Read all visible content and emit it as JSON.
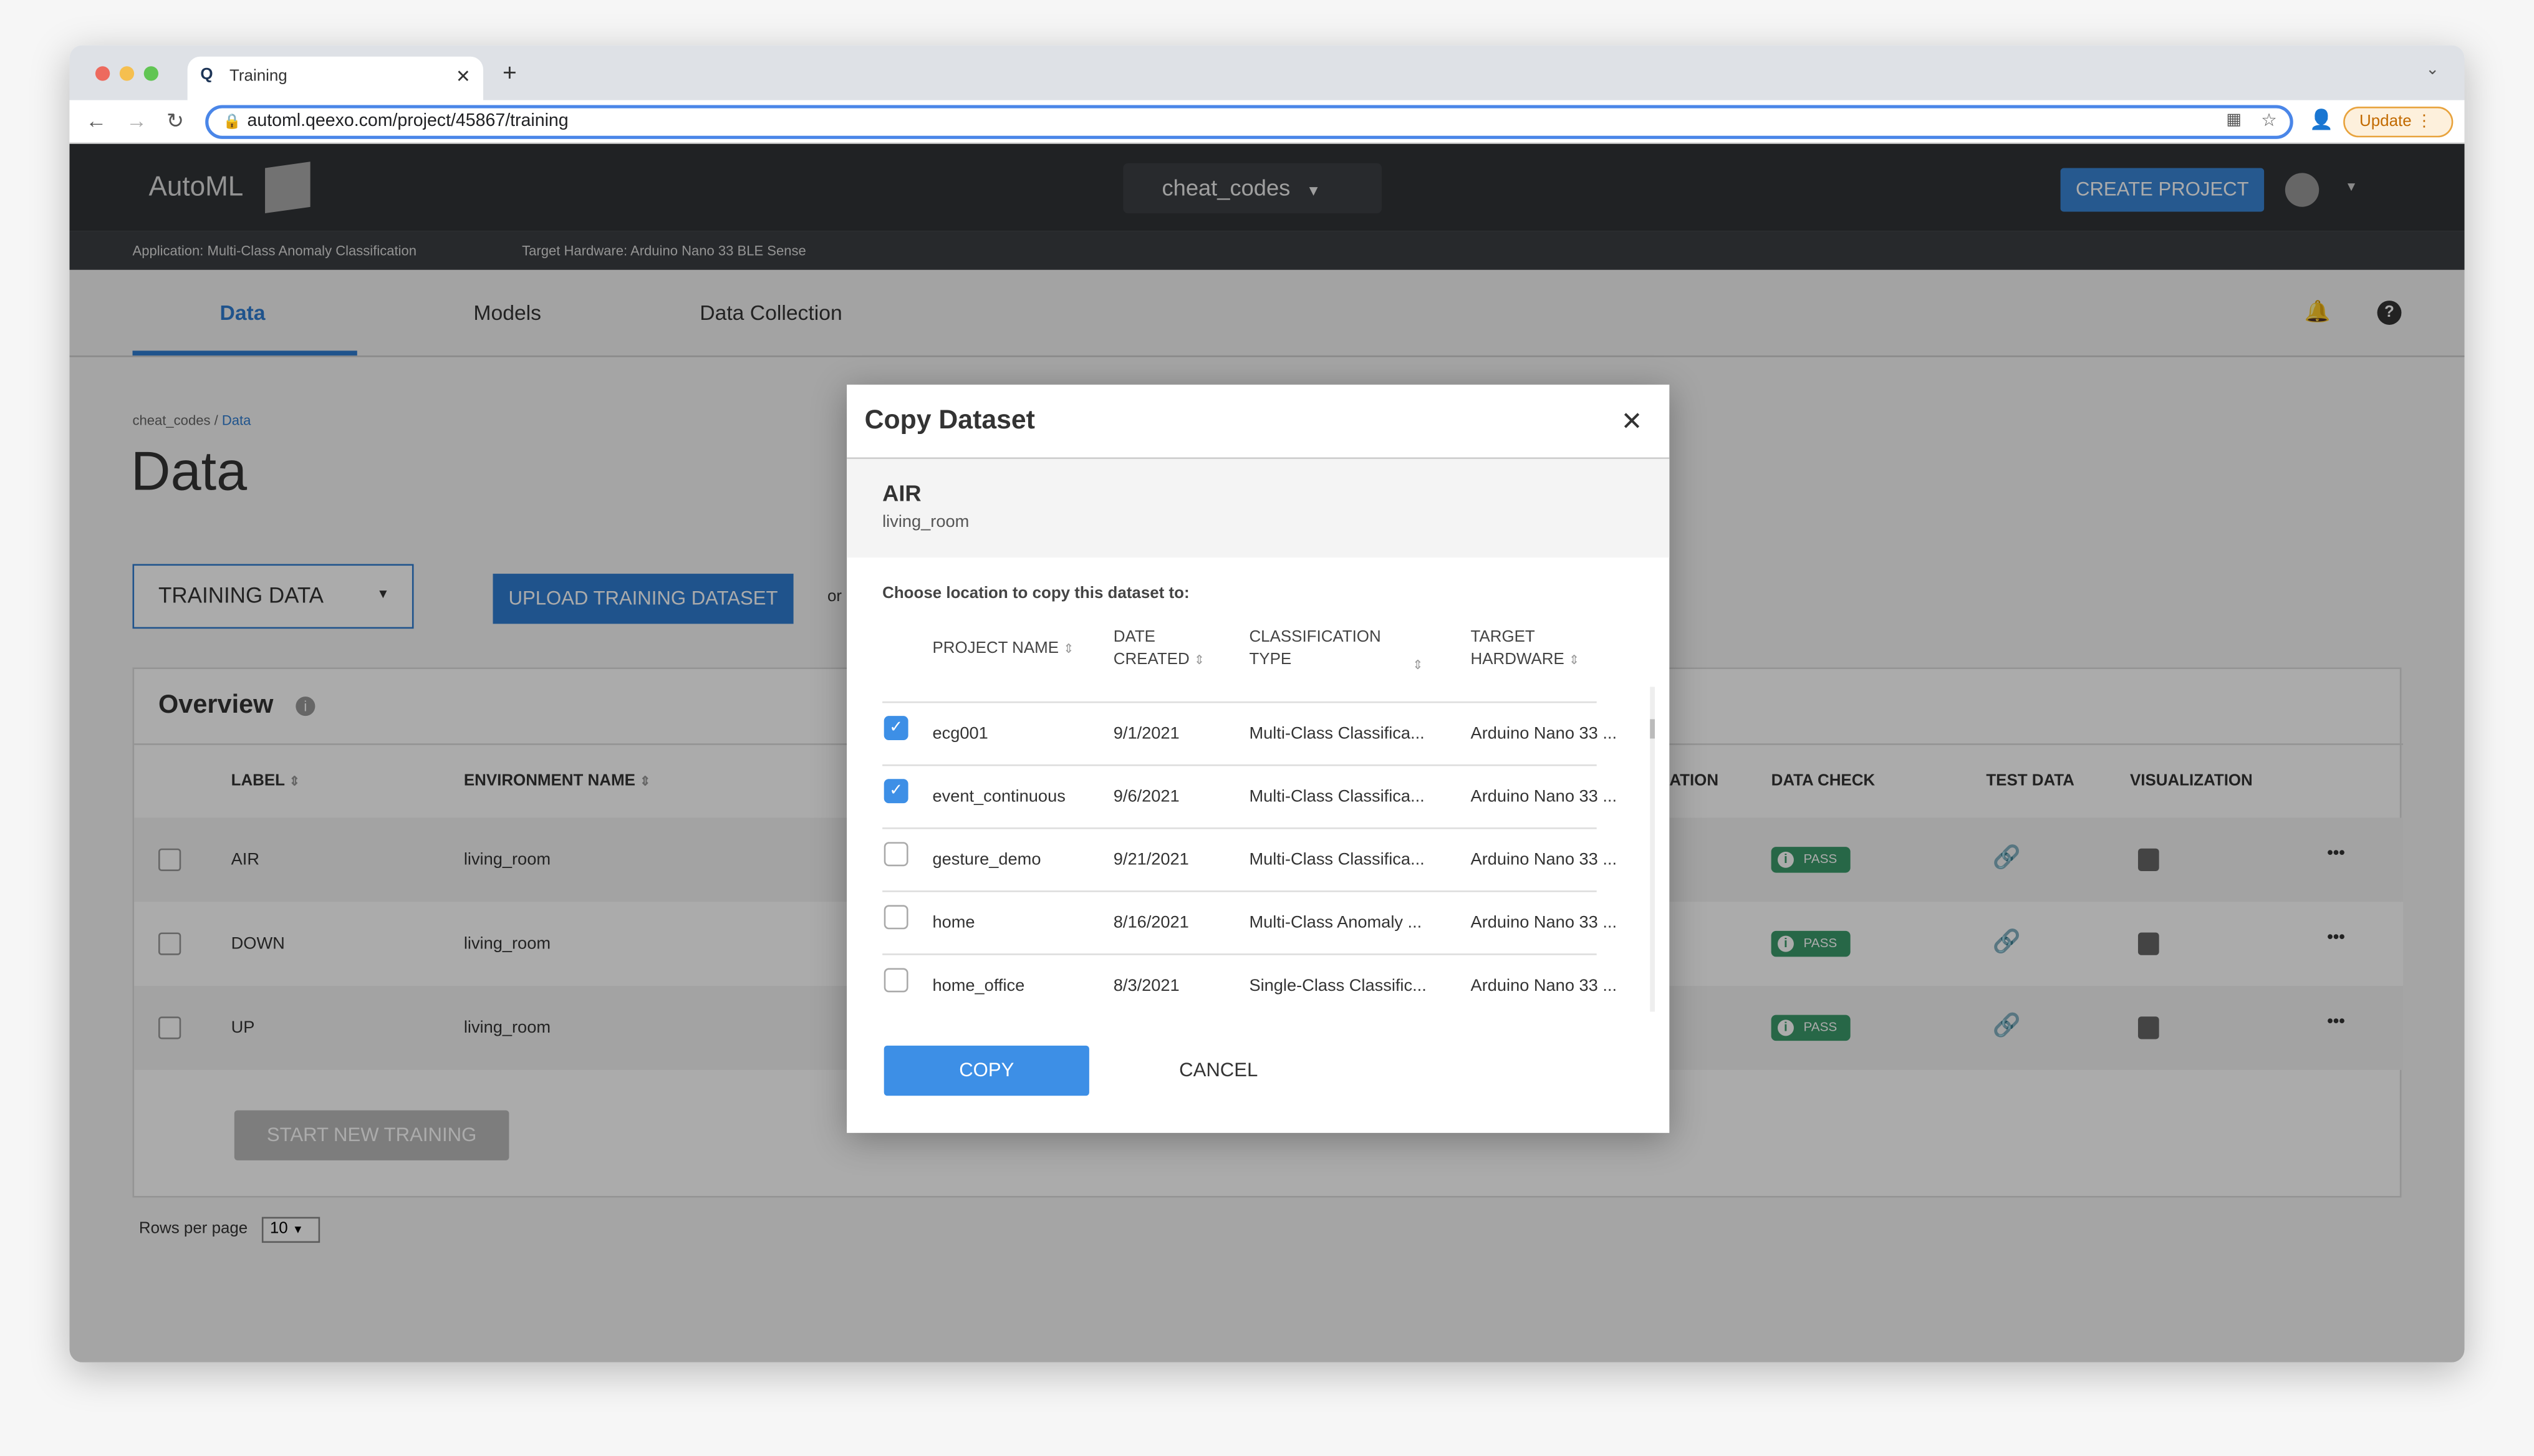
{
  "browser": {
    "tab_title": "Training",
    "url": "automl.qeexo.com/project/45867/training",
    "update_label": "Update"
  },
  "header": {
    "logo": "AutoML",
    "project_selector": "cheat_codes",
    "create_project": "CREATE PROJECT"
  },
  "subbar": {
    "application": "Application: Multi-Class Anomaly Classification",
    "hardware": "Target Hardware: Arduino Nano 33 BLE Sense"
  },
  "nav": {
    "tabs": [
      {
        "label": "Data",
        "active": true
      },
      {
        "label": "Models"
      },
      {
        "label": "Data Collection"
      }
    ]
  },
  "breadcrumb": {
    "project": "cheat_codes",
    "sep": " / ",
    "current": "Data"
  },
  "page": {
    "title": "Data",
    "data_type": "TRAINING DATA",
    "upload_button": "UPLOAD TRAINING DATASET",
    "or": "or",
    "overview": "Overview",
    "start_training": "START NEW TRAINING",
    "rows_per_page_label": "Rows per page",
    "rows_per_page": "10"
  },
  "table": {
    "headers": {
      "label": "LABEL",
      "env": "ENVIRONMENT NAME",
      "ation": "ATION",
      "data_check": "DATA CHECK",
      "test_data": "TEST DATA",
      "visualization": "VISUALIZATION"
    },
    "rows": [
      {
        "label": "AIR",
        "env": "living_room",
        "check": "PASS"
      },
      {
        "label": "DOWN",
        "env": "living_room",
        "check": "PASS"
      },
      {
        "label": "UP",
        "env": "living_room",
        "check": "PASS"
      }
    ]
  },
  "modal": {
    "title": "Copy Dataset",
    "dataset_label": "AIR",
    "dataset_env": "living_room",
    "prompt": "Choose location to copy this dataset to:",
    "headers": {
      "name": "PROJECT NAME",
      "date1": "DATE",
      "date2": "CREATED",
      "class1": "CLASSIFICATION",
      "class2": "TYPE",
      "hw1": "TARGET",
      "hw2": "HARDWARE"
    },
    "rows": [
      {
        "name": "ecg001",
        "date": "9/1/2021",
        "type": "Multi-Class Classifica...",
        "hw": "Arduino Nano 33 ...",
        "checked": true
      },
      {
        "name": "event_continuous",
        "date": "9/6/2021",
        "type": "Multi-Class Classifica...",
        "hw": "Arduino Nano 33 ...",
        "checked": true
      },
      {
        "name": "gesture_demo",
        "date": "9/21/2021",
        "type": "Multi-Class Classifica...",
        "hw": "Arduino Nano 33 ...",
        "checked": false
      },
      {
        "name": "home",
        "date": "8/16/2021",
        "type": "Multi-Class Anomaly ...",
        "hw": "Arduino Nano 33 ...",
        "checked": false
      },
      {
        "name": "home_office",
        "date": "8/3/2021",
        "type": "Single-Class Classific...",
        "hw": "Arduino Nano 33 ...",
        "checked": false
      }
    ],
    "copy": "COPY",
    "cancel": "CANCEL"
  },
  "colors": {
    "accent": "#3d8fe6",
    "header": "#303336",
    "pass": "#3b9a6a"
  }
}
